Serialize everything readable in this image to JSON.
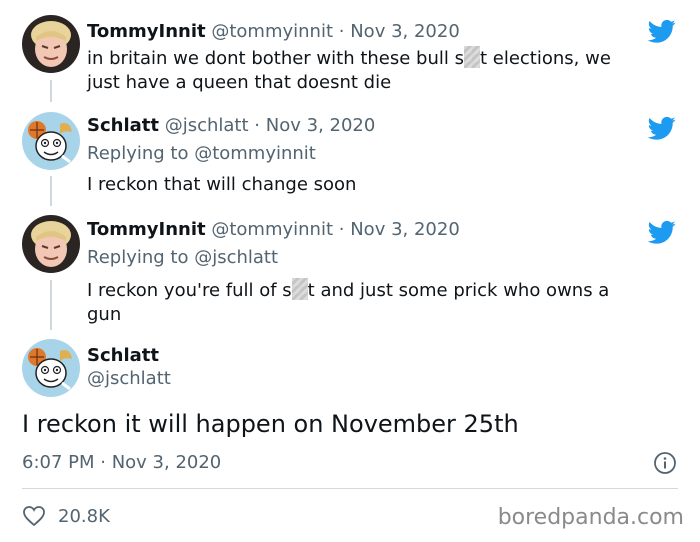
{
  "tweets": [
    {
      "name": "TommyInnit",
      "handle": "@tommyinnit",
      "separator": "·",
      "date": "Nov 3, 2020",
      "text_a": "in britain we dont bother with these bull s",
      "text_b": "t elections, we",
      "text_c": "just have a queen that doesnt die"
    },
    {
      "name": "Schlatt",
      "handle": "@jschlatt",
      "separator": "·",
      "date": "Nov 3, 2020",
      "replying": "Replying to @tommyinnit",
      "text": "I reckon that will change soon"
    },
    {
      "name": "TommyInnit",
      "handle": "@tommyinnit",
      "separator": "·",
      "date": "Nov 3, 2020",
      "replying": "Replying to @jschlatt",
      "text_a": "I reckon you're full of s",
      "text_b": "t and just some prick who owns a",
      "text_c": "gun"
    }
  ],
  "main_tweet": {
    "name": "Schlatt",
    "handle": "@jschlatt",
    "text": "I reckon it will happen on November 25th",
    "timestamp": "6:07 PM · Nov 3, 2020",
    "likes": "20.8K"
  },
  "watermark": "boredpanda.com",
  "colors": {
    "twitter_blue": "#1d9bf0",
    "muted": "#536471",
    "divider": "#cfd9de"
  },
  "icons": [
    "twitter-bird-icon",
    "info-icon",
    "heart-icon"
  ]
}
